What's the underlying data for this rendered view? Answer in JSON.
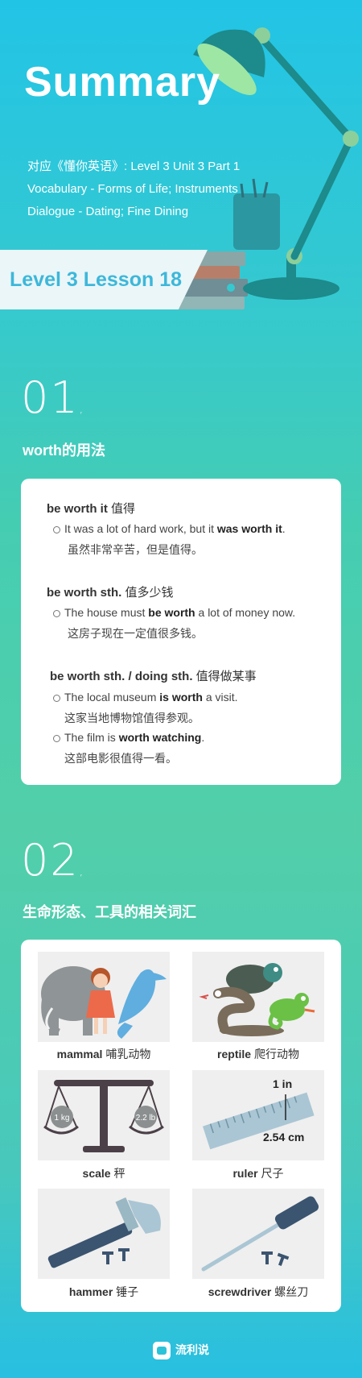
{
  "hero": {
    "title": "Summary",
    "line1": "对应《懂你英语》: Level 3 Unit 3 Part 1",
    "line2": "Vocabulary - Forms of Life; Instruments",
    "line3": "Dialogue - Dating; Fine Dining",
    "lesson": "Level 3 Lesson 18"
  },
  "section1": {
    "number": "01",
    "title": "worth的用法",
    "groups": [
      {
        "phrase_en": "be worth it",
        "phrase_zh": " 值得",
        "examples": [
          {
            "en_pre": "It was a lot of hard work, but it ",
            "en_bold": "was worth it",
            "en_post": ".",
            "zh": "虽然非常辛苦，但是值得。"
          }
        ]
      },
      {
        "phrase_en": "be worth sth.",
        "phrase_zh": " 值多少钱",
        "examples": [
          {
            "en_pre": "The house must ",
            "en_bold": "be worth",
            "en_post": " a lot of money now.",
            "zh": "这房子现在一定值很多钱。"
          }
        ]
      },
      {
        "phrase_en": "be worth sth. / doing sth.",
        "phrase_zh": " 值得做某事",
        "examples": [
          {
            "en_pre": "The local museum ",
            "en_bold": "is worth",
            "en_post": " a visit.",
            "zh": "这家当地博物馆值得参观。"
          },
          {
            "en_pre": "The film is ",
            "en_bold": "worth watching",
            "en_post": ".",
            "zh": "这部电影很值得一看。"
          }
        ]
      }
    ]
  },
  "section2": {
    "number": "02",
    "title": "生命形态、工具的相关词汇",
    "items": [
      {
        "en": "mammal",
        "zh": " 哺乳动物",
        "icon": "mammal-icon"
      },
      {
        "en": "reptile",
        "zh": " 爬行动物",
        "icon": "reptile-icon"
      },
      {
        "en": "scale",
        "zh": " 秤",
        "icon": "scale-icon",
        "left_label": "1 kg",
        "right_label": "2.2 lb"
      },
      {
        "en": "ruler",
        "zh": " 尺子",
        "icon": "ruler-icon",
        "top_label": "1 in",
        "bottom_label": "2.54 cm"
      },
      {
        "en": "hammer",
        "zh": " 锤子",
        "icon": "hammer-icon"
      },
      {
        "en": "screwdriver",
        "zh": " 螺丝刀",
        "icon": "screwdriver-icon"
      }
    ]
  },
  "footer": {
    "brand": "流利说"
  },
  "colors": {
    "accent": "#3db7da",
    "lamp": "#1d8a8c",
    "hero_bg": "#22c4e6"
  }
}
